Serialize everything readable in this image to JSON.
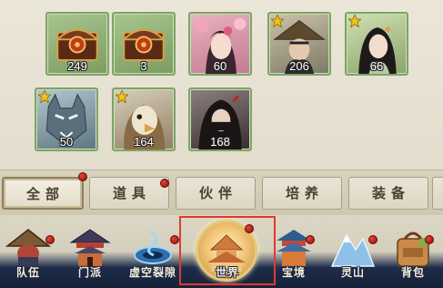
{
  "inventory": {
    "items": [
      {
        "qty": "249",
        "icon": "treasure-chest-icon",
        "starred": false
      },
      {
        "qty": "3",
        "icon": "treasure-chest-icon",
        "starred": false
      },
      {
        "qty": "60",
        "icon": "flower-maiden-portrait",
        "starred": false
      },
      {
        "qty": "206",
        "icon": "straw-hat-warrior-portrait",
        "starred": true
      },
      {
        "qty": "66",
        "icon": "lady-portrait",
        "starred": true
      },
      {
        "qty": "50",
        "icon": "wolf-beast-portrait",
        "starred": true
      },
      {
        "qty": "164",
        "icon": "eagle-beast-portrait",
        "starred": true
      },
      {
        "qty": "168",
        "icon": "masked-assassin-portrait",
        "starred": false
      }
    ]
  },
  "tabs": [
    {
      "label": "全部",
      "active": true,
      "badge": true
    },
    {
      "label": "道具",
      "active": false,
      "badge": true
    },
    {
      "label": "伙伴",
      "active": false,
      "badge": false
    },
    {
      "label": "培养",
      "active": false,
      "badge": false
    },
    {
      "label": "装备",
      "active": false,
      "badge": false
    }
  ],
  "nav": [
    {
      "label": "队伍",
      "icon": "team-hat-icon",
      "badge": true
    },
    {
      "label": "门派",
      "icon": "sect-pavilion-icon",
      "badge": false
    },
    {
      "label": "虚空裂隙",
      "icon": "void-rift-icon",
      "badge": true
    },
    {
      "label": "世界",
      "icon": "world-city-icon",
      "badge": true,
      "highlighted": true
    },
    {
      "label": "宝境",
      "icon": "treasure-realm-pagoda-icon",
      "badge": true
    },
    {
      "label": "灵山",
      "icon": "spirit-mountain-icon",
      "badge": true
    },
    {
      "label": "背包",
      "icon": "backpack-icon",
      "badge": true
    }
  ],
  "colors": {
    "slot_green": "#8fb275",
    "badge_red": "#b8201a",
    "highlight_frame": "#e03a2f",
    "nav_dark": "#1d2c4a"
  }
}
